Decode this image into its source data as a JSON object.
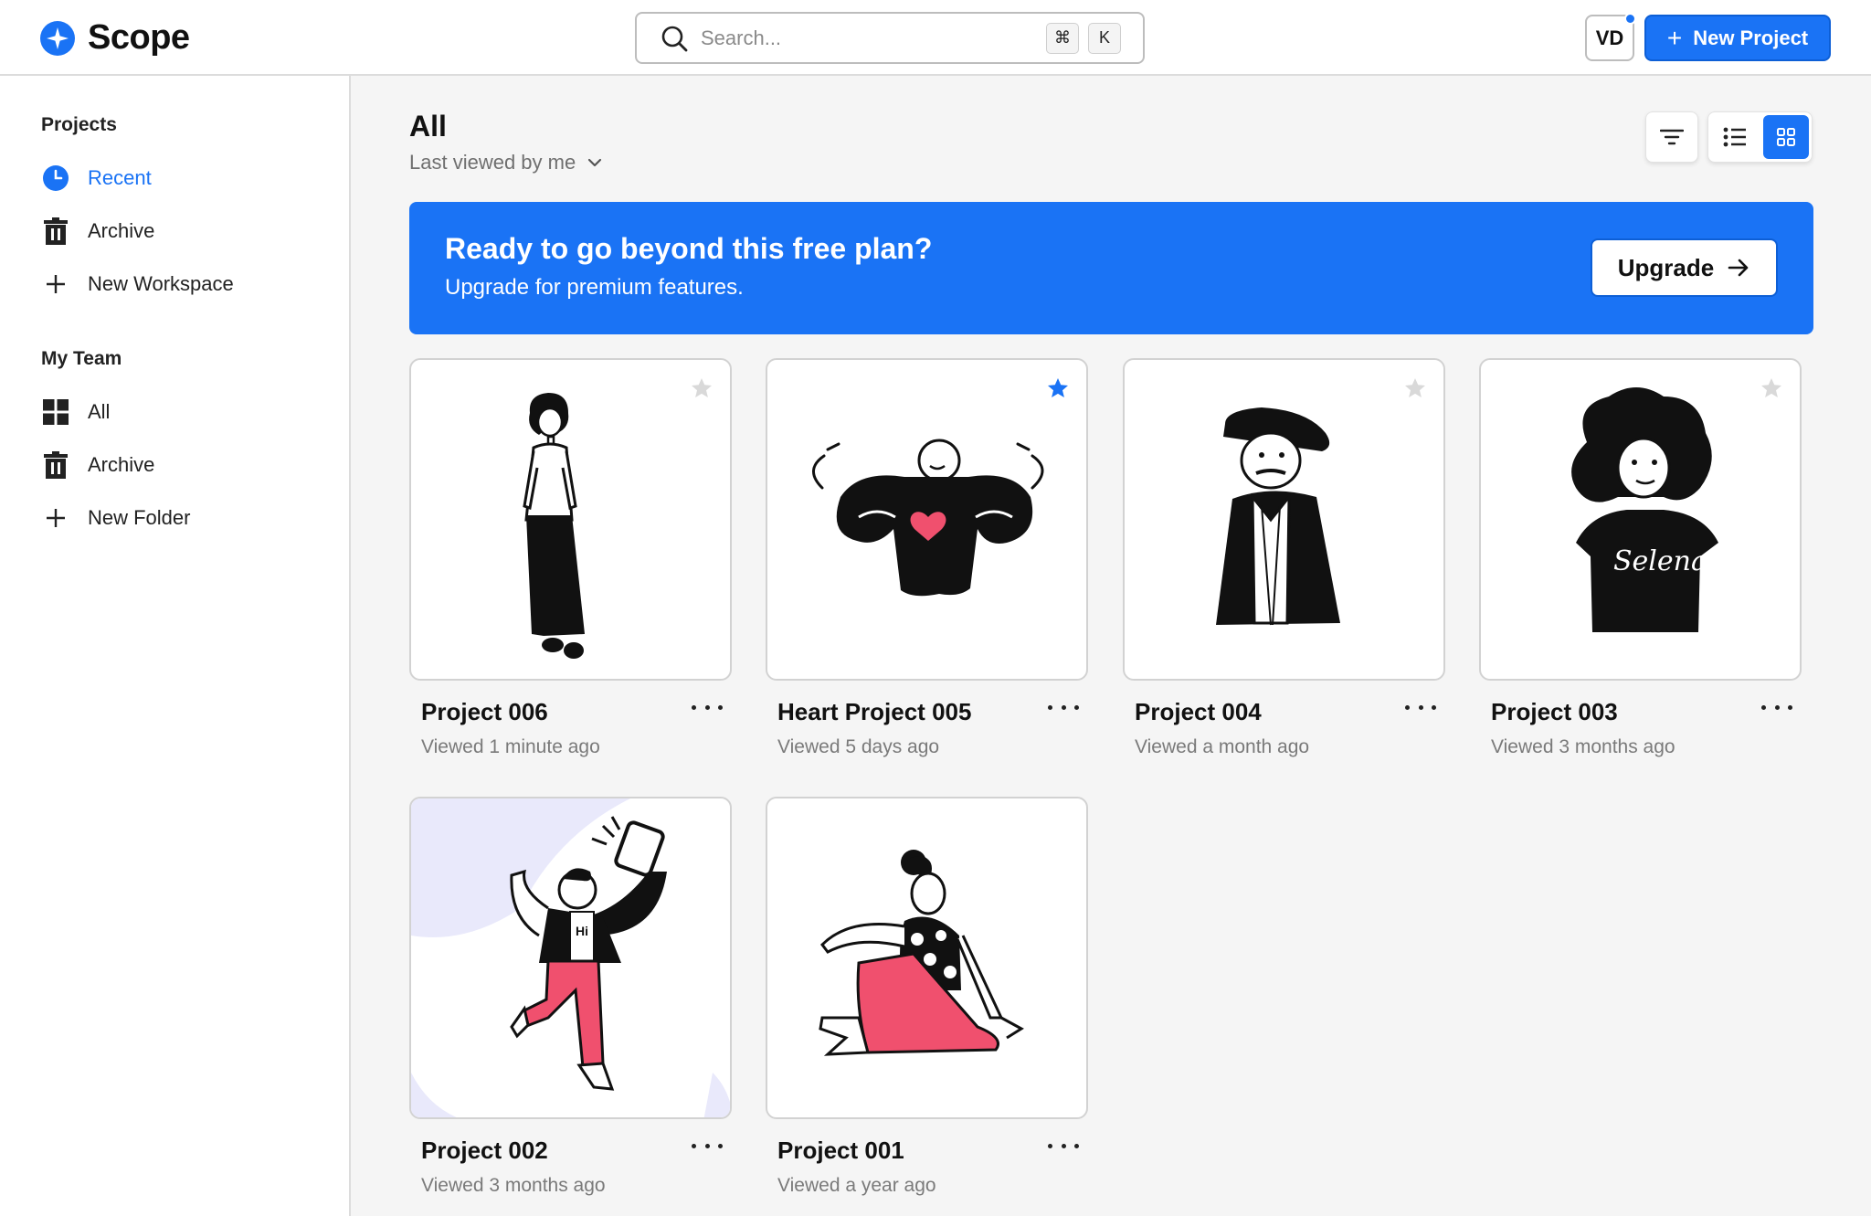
{
  "app": {
    "name": "Scope"
  },
  "search": {
    "placeholder": "Search...",
    "shortcut_mod": "⌘",
    "shortcut_key": "K"
  },
  "user": {
    "initials": "VD"
  },
  "header": {
    "new_project_label": "New Project"
  },
  "sidebar": {
    "projects_heading": "Projects",
    "project_items": [
      {
        "label": "Recent",
        "icon": "clock-icon",
        "active": true
      },
      {
        "label": "Archive",
        "icon": "trash-icon"
      },
      {
        "label": "New Workspace",
        "icon": "plus-icon"
      }
    ],
    "team_heading": "My Team",
    "team_items": [
      {
        "label": "All",
        "icon": "grid-icon"
      },
      {
        "label": "Archive",
        "icon": "trash-icon"
      },
      {
        "label": "New Folder",
        "icon": "plus-icon"
      }
    ]
  },
  "main": {
    "title": "All",
    "sort_label": "Last viewed by me",
    "view_mode": "grid"
  },
  "banner": {
    "title": "Ready to go beyond this free plan?",
    "subtitle": "Upgrade for premium features.",
    "button_label": "Upgrade"
  },
  "projects": [
    {
      "title": "Project 006",
      "meta": "Viewed 1 minute ago",
      "starred": false
    },
    {
      "title": "Heart Project 005",
      "meta": "Viewed 5 days ago",
      "starred": true
    },
    {
      "title": "Project 004",
      "meta": "Viewed a month ago",
      "starred": false
    },
    {
      "title": "Project 003",
      "meta": "Viewed 3 months ago",
      "starred": false
    },
    {
      "title": "Project 002",
      "meta": "Viewed 3 months ago",
      "starred": false
    },
    {
      "title": "Project 001",
      "meta": "Viewed a year ago",
      "starred": false
    }
  ],
  "illustration_text": {
    "shirt": "Selena",
    "hi": "Hi"
  },
  "colors": {
    "accent": "#1a73f5",
    "heart": "#f0506e",
    "star_off": "#d9d9d9"
  }
}
